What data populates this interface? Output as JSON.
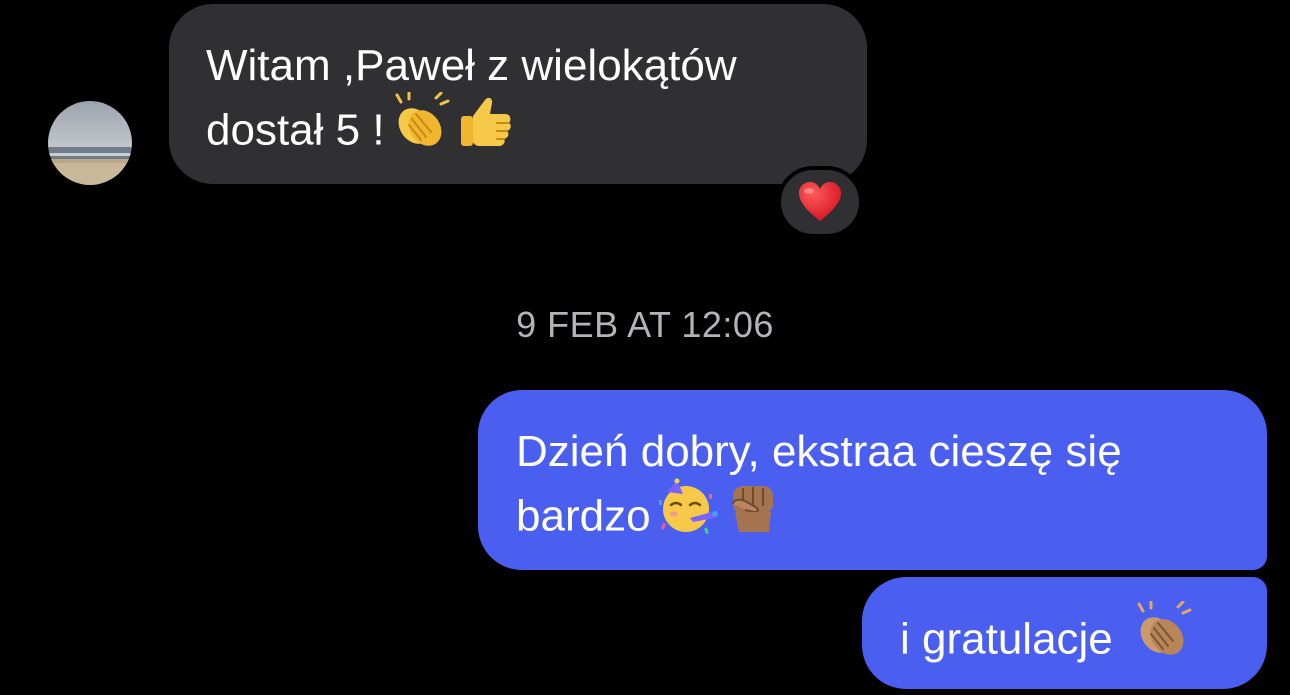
{
  "incoming_message": {
    "line1": "Witam ,Paweł z wielokątów",
    "line2": "dostał 5 !",
    "emojis": [
      "clapping-hands-icon",
      "thumbs-up-icon"
    ],
    "reaction": "red-heart-icon"
  },
  "timestamp": "9 FEB AT 12:06",
  "outgoing_messages": [
    {
      "line1": "Dzień dobry, ekstraa cieszę się",
      "line2": "bardzo",
      "emojis": [
        "partying-face-icon",
        "raised-fist-icon"
      ]
    },
    {
      "line1": "i gratulacje",
      "emojis": [
        "clapping-hands-icon"
      ]
    }
  ],
  "colors": {
    "background": "#000000",
    "incoming_bubble": "#303032",
    "outgoing_bubble": "#4a5ff0",
    "timestamp_text": "#b3b3b8",
    "message_text": "#ffffff"
  }
}
